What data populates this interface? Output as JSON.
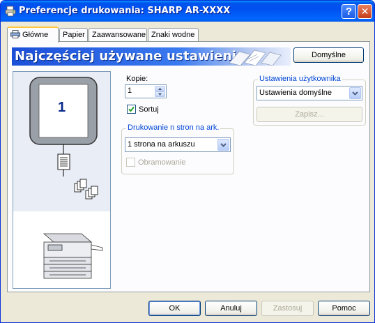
{
  "window": {
    "title": "Preferencje drukowania: SHARP AR-XXXX",
    "help_label": "?",
    "close_label": "✕"
  },
  "tabs": [
    {
      "label": "Główne",
      "active": true
    },
    {
      "label": "Papier",
      "active": false
    },
    {
      "label": "Zaawansowane",
      "active": false
    },
    {
      "label": "Znaki wodne",
      "active": false
    }
  ],
  "banner": {
    "text": "Najczęściej używane ustawienia",
    "defaults_button": "Domyślne"
  },
  "preview": {
    "page_number": "1"
  },
  "copies": {
    "label": "Kopie:",
    "value": "1",
    "collate_label": "Sortuj",
    "collate_checked": true
  },
  "nup": {
    "group_title": "Drukowanie n stron na ark.",
    "selected": "1 strona na arkuszu",
    "border_label": "Obramowanie",
    "border_checked": false,
    "border_enabled": false
  },
  "user_settings": {
    "group_title": "Ustawienia użytkownika",
    "selected": "Ustawienia domyślne",
    "save_button": "Zapisz...",
    "save_enabled": false
  },
  "footer": {
    "ok": "OK",
    "cancel": "Anuluj",
    "apply": "Zastosuj",
    "help": "Pomoc"
  },
  "colors": {
    "title_bar": "#0054e3",
    "accent": "#0046d5",
    "tab_highlight": "#ffc83c"
  }
}
